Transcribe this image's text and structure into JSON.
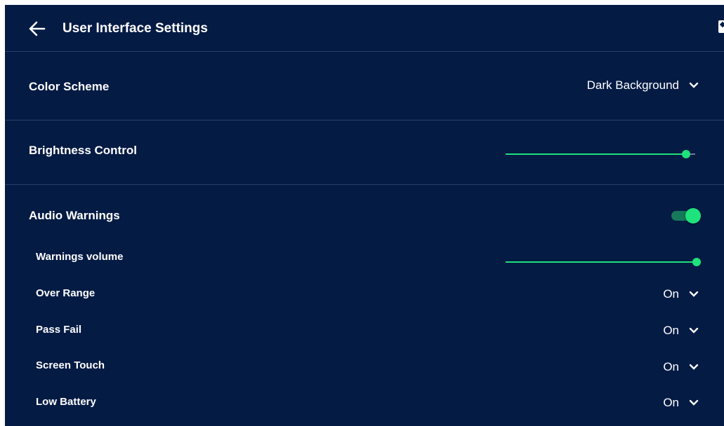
{
  "header": {
    "title": "User Interface Settings",
    "back_icon": "arrow-left-icon",
    "corner_icon": "app-icon"
  },
  "settings": {
    "color_scheme": {
      "label": "Color Scheme",
      "value": "Dark Background"
    },
    "brightness": {
      "label": "Brightness Control",
      "level": 0.95
    },
    "audio_warnings": {
      "label": "Audio Warnings",
      "enabled": true
    },
    "warnings_volume": {
      "label": "Warnings volume",
      "level": 1.0
    },
    "over_range": {
      "label": "Over Range",
      "value": "On"
    },
    "pass_fail": {
      "label": "Pass Fail",
      "value": "On"
    },
    "screen_touch": {
      "label": "Screen Touch",
      "value": "On"
    },
    "low_battery": {
      "label": "Low Battery",
      "value": "On"
    }
  },
  "colors": {
    "background": "#041b44",
    "accent": "#1ee27a",
    "divider": "#2b3f66"
  }
}
